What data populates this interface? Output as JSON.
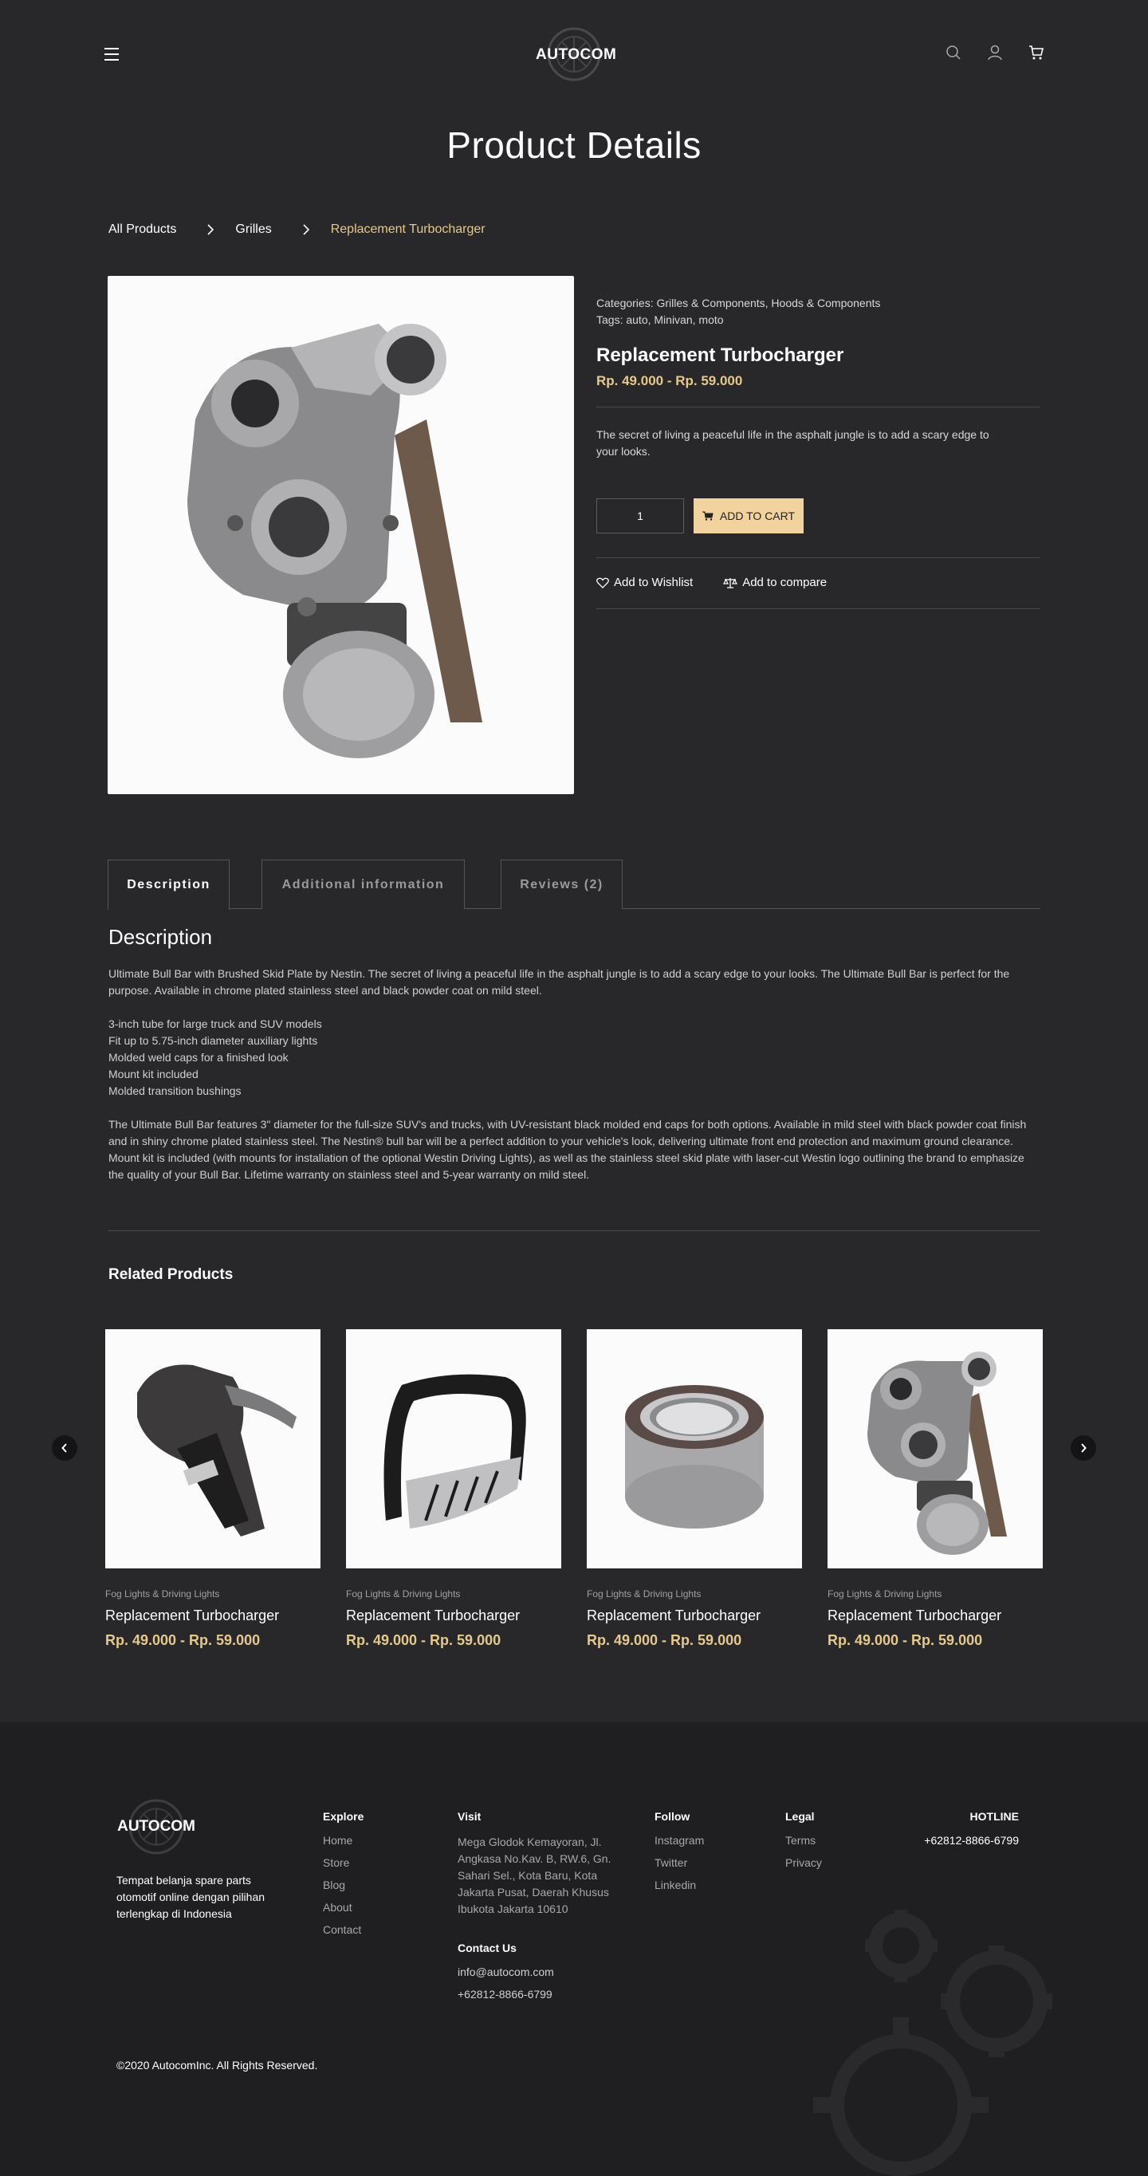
{
  "header": {
    "logo_text": "AUTOCOM"
  },
  "page_title": "Product Details",
  "breadcrumb": [
    "All Products",
    "Grilles",
    "Replacement Turbocharger"
  ],
  "product": {
    "categories_label": "Categories:",
    "categories": "Grilles & Components, Hoods & Components",
    "tags_label": "Tags:",
    "tags": "auto, Minivan, moto",
    "name": "Replacement Turbocharger",
    "price": "Rp. 49.000 - Rp. 59.000",
    "short_desc": "The secret of living a peaceful life in the asphalt jungle is to add a scary edge to your looks.",
    "quantity": "1",
    "add_to_cart": "ADD TO CART",
    "add_to_wishlist": "Add to Wishlist",
    "add_to_compare": "Add to compare"
  },
  "tabs": [
    "Description",
    "Additional information",
    "Reviews (2)"
  ],
  "description": {
    "heading": "Description",
    "intro": "Ultimate Bull Bar with Brushed Skid Plate by Nestin. The secret of living a peaceful life in the asphalt jungle is to add a scary edge to your looks. The Ultimate Bull Bar is perfect for the purpose. Available in chrome plated stainless steel and black powder coat on mild steel.",
    "features": [
      "3-inch tube for large truck and SUV models",
      "Fit up to 5.75-inch diameter auxiliary lights",
      "Molded weld caps for a finished look",
      "Mount kit included",
      "Molded transition bushings"
    ],
    "details": "The Ultimate Bull Bar features 3\" diameter for the full-size SUV's and trucks, with UV-resistant black molded end caps for both options. Available in mild steel with black powder coat finish and in shiny chrome plated stainless steel. The Nestin® bull bar will be a perfect addition to your vehicle's look, delivering ultimate front end protection and maximum ground clearance. Mount kit is included (with mounts for installation of the optional Westin Driving Lights), as well as the stainless steel skid plate with laser-cut Westin logo outlining the brand to emphasize the quality of your Bull Bar. Lifetime warranty on stainless steel and 5-year warranty on mild steel."
  },
  "related": {
    "title": "Related Products",
    "items": [
      {
        "category": "Fog Lights & Driving Lights",
        "name": "Replacement Turbocharger",
        "price": "Rp. 49.000 - Rp. 59.000"
      },
      {
        "category": "Fog Lights & Driving Lights",
        "name": "Replacement Turbocharger",
        "price": "Rp. 49.000 - Rp. 59.000"
      },
      {
        "category": "Fog Lights & Driving Lights",
        "name": "Replacement Turbocharger",
        "price": "Rp. 49.000 - Rp. 59.000"
      },
      {
        "category": "Fog Lights & Driving Lights",
        "name": "Replacement Turbocharger",
        "price": "Rp. 49.000 - Rp. 59.000"
      }
    ]
  },
  "footer": {
    "logo_text": "AUTOCOM",
    "tagline": "Tempat belanja spare parts otomotif online dengan pilihan terlengkap di Indonesia",
    "explore": {
      "title": "Explore",
      "links": [
        "Home",
        "Store",
        "Blog",
        "About",
        "Contact"
      ]
    },
    "visit": {
      "title": "Visit",
      "address": "Mega Glodok Kemayoran, Jl. Angkasa No.Kav. B, RW.6, Gn. Sahari Sel., Kota Baru, Kota Jakarta Pusat, Daerah Khusus Ibukota Jakarta 10610"
    },
    "contact": {
      "title": "Contact Us",
      "email": "info@autocom.com",
      "phone": "+62812-8866-6799"
    },
    "follow": {
      "title": "Follow",
      "links": [
        "Instagram",
        "Twitter",
        "Linkedin"
      ]
    },
    "legal": {
      "title": "Legal",
      "links": [
        "Terms",
        "Privacy"
      ]
    },
    "hotline": {
      "title": "HOTLINE",
      "phone": "+62812-8866-6799"
    },
    "copyright": "©2020 AutocomInc. All Rights Reserved."
  },
  "colors": {
    "background": "#28282a",
    "footer": "#1f1f21",
    "accent": "#e6c98a",
    "button": "#f2d29d"
  }
}
